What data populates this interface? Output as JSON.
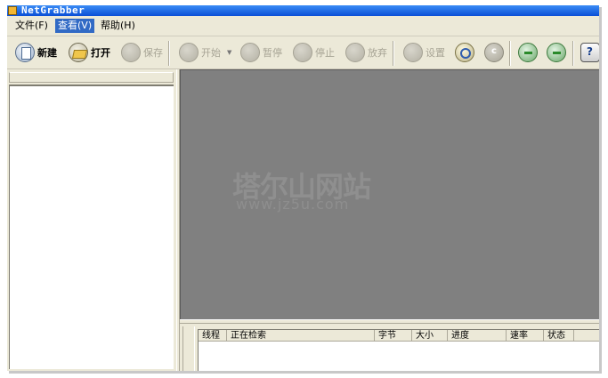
{
  "window": {
    "title": "NetGrabber"
  },
  "menu": [
    {
      "label": "文件(F)"
    },
    {
      "label": "查看(V)",
      "active": true
    },
    {
      "label": "帮助(H)"
    }
  ],
  "toolbar": {
    "new_label": "新建",
    "open_label": "打开",
    "save_label": "保存",
    "start_label": "开始",
    "pause_label": "暂停",
    "stop_label": "停止",
    "abandon_label": "放弃",
    "settings_label": "设置"
  },
  "watermark": {
    "line1": "塔尔山网站",
    "line2": "www.jz5u.com"
  },
  "task_table": {
    "columns": [
      "线程",
      "正在检索",
      "字节",
      "大小",
      "进度",
      "速率",
      "状态"
    ]
  },
  "colors": {
    "titlebar": "#0a4fd6",
    "menu_active": "#316ac5",
    "main_view": "#808080",
    "chrome": "#ece9d8"
  }
}
